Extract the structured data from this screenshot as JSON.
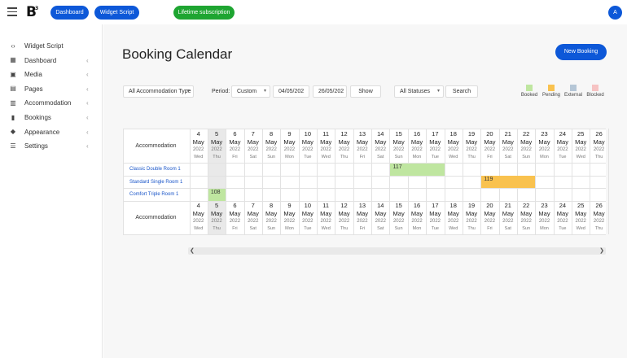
{
  "topbar": {
    "logo": "B",
    "buttons": [
      {
        "label": "Dashboard",
        "color": "#0d58d8"
      },
      {
        "label": "Widget Script",
        "color": "#0d58d8"
      }
    ],
    "subscription_label": "Lifetime subscription",
    "avatar_letter": "A"
  },
  "sidebar": {
    "items": [
      {
        "label": "Widget Script",
        "icon": "code-icon",
        "chevron": false
      },
      {
        "label": "Dashboard",
        "icon": "grid-icon",
        "chevron": true
      },
      {
        "label": "Media",
        "icon": "image-icon",
        "chevron": true
      },
      {
        "label": "Pages",
        "icon": "file-icon",
        "chevron": true
      },
      {
        "label": "Accommodation",
        "icon": "building-icon",
        "chevron": true
      },
      {
        "label": "Bookings",
        "icon": "book-icon",
        "chevron": true
      },
      {
        "label": "Appearance",
        "icon": "paint-icon",
        "chevron": true
      },
      {
        "label": "Settings",
        "icon": "sliders-icon",
        "chevron": true
      }
    ]
  },
  "page": {
    "title": "Booking Calendar",
    "new_booking_label": "New Booking"
  },
  "filters": {
    "accommodation_type": "All Accommodation Type",
    "period_label": "Period:",
    "period_value": "Custom",
    "date_from": "04/05/202",
    "date_to": "26/05/202",
    "show_label": "Show",
    "status_value": "All Statuses",
    "search_label": "Search"
  },
  "legend": [
    {
      "label": "Booked",
      "color": "#bfe6a0"
    },
    {
      "label": "Pending",
      "color": "#f9c24f"
    },
    {
      "label": "External",
      "color": "#b5c6d6"
    },
    {
      "label": "Blocked",
      "color": "#f6c3c3"
    }
  ],
  "calendar": {
    "header_label": "Accommodation",
    "month": "May",
    "year": "2022",
    "today_index": 1,
    "days": [
      {
        "n": "4",
        "w": "Wed"
      },
      {
        "n": "5",
        "w": "Thu"
      },
      {
        "n": "6",
        "w": "Fri"
      },
      {
        "n": "7",
        "w": "Sat"
      },
      {
        "n": "8",
        "w": "Sun"
      },
      {
        "n": "9",
        "w": "Mon"
      },
      {
        "n": "10",
        "w": "Tue"
      },
      {
        "n": "11",
        "w": "Wed"
      },
      {
        "n": "12",
        "w": "Thu"
      },
      {
        "n": "13",
        "w": "Fri"
      },
      {
        "n": "14",
        "w": "Sat"
      },
      {
        "n": "15",
        "w": "Sun"
      },
      {
        "n": "16",
        "w": "Mon"
      },
      {
        "n": "17",
        "w": "Tue"
      },
      {
        "n": "18",
        "w": "Wed"
      },
      {
        "n": "19",
        "w": "Thu"
      },
      {
        "n": "20",
        "w": "Fri"
      },
      {
        "n": "21",
        "w": "Sat"
      },
      {
        "n": "22",
        "w": "Sun"
      },
      {
        "n": "23",
        "w": "Mon"
      },
      {
        "n": "24",
        "w": "Tue"
      },
      {
        "n": "25",
        "w": "Wed"
      },
      {
        "n": "26",
        "w": "Thu"
      }
    ],
    "rooms": [
      {
        "name": "Classic Double Room 1"
      },
      {
        "name": "Standard Single Room 1"
      },
      {
        "name": "Comfort Triple Room 1"
      }
    ],
    "bookings": [
      {
        "id": "117",
        "room": 0,
        "start": 11,
        "span": 3,
        "status": "Booked"
      },
      {
        "id": "119",
        "room": 1,
        "start": 16,
        "span": 3,
        "status": "Pending"
      },
      {
        "id": "108",
        "room": 2,
        "start": 1,
        "span": 1,
        "status": "Booked"
      }
    ]
  }
}
